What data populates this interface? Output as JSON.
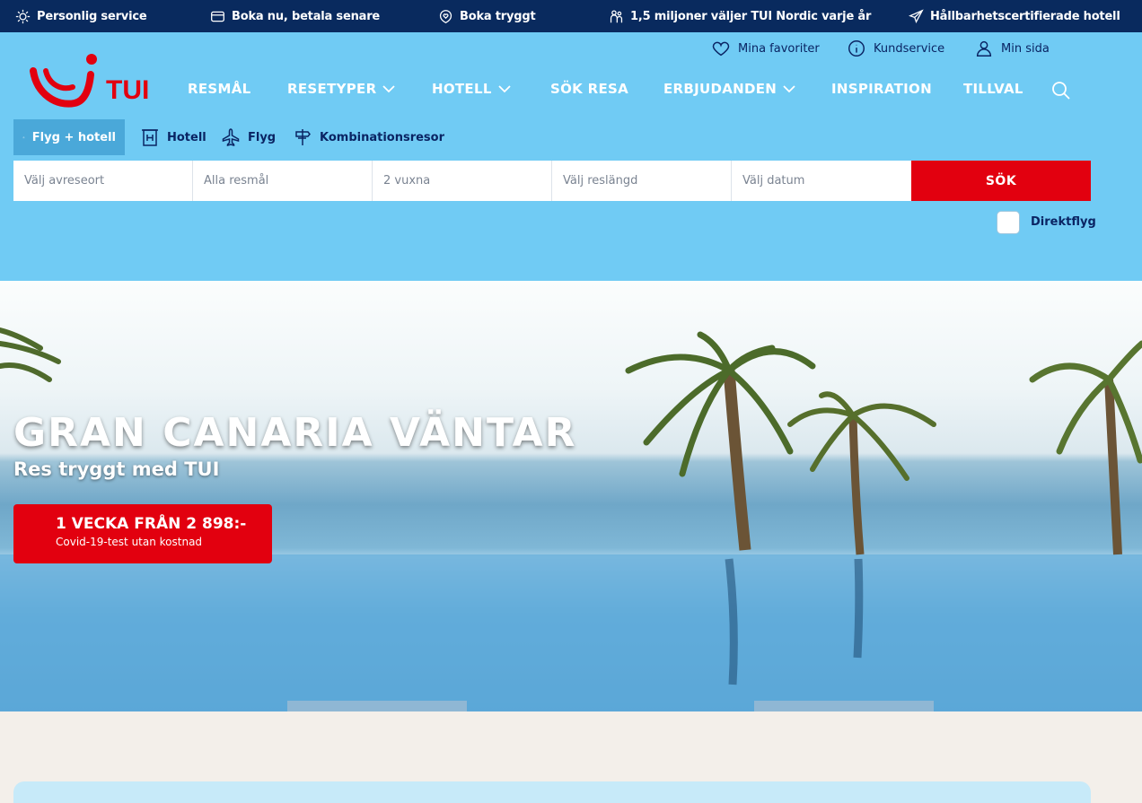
{
  "topbar": {
    "items": [
      {
        "label": "Personlig service",
        "icon": "sun-icon"
      },
      {
        "label": "Boka nu, betala senare",
        "icon": "card-icon"
      },
      {
        "label": "Boka tryggt",
        "icon": "shield-heart-icon"
      },
      {
        "label": "1,5 miljoner väljer TUI Nordic varje år",
        "icon": "people-icon"
      },
      {
        "label": "Hållbarhetscertifierade hotell",
        "icon": "paper-plane-icon"
      }
    ]
  },
  "utility": {
    "favorites": "Mina favoriter",
    "service": "Kundservice",
    "account": "Min sida"
  },
  "logo": {
    "text": "TUI"
  },
  "nav": {
    "items": [
      {
        "label": "RESMÅL",
        "dropdown": false
      },
      {
        "label": "RESETYPER",
        "dropdown": true
      },
      {
        "label": "HOTELL",
        "dropdown": true
      },
      {
        "label": "SÖK RESA",
        "dropdown": false
      },
      {
        "label": "ERBJUDANDEN",
        "dropdown": true
      },
      {
        "label": "INSPIRATION",
        "dropdown": false
      },
      {
        "label": "TILLVAL",
        "dropdown": false
      }
    ]
  },
  "search": {
    "tabs": [
      {
        "label": "Flyg + hotell",
        "icon": "sun-icon",
        "active": true
      },
      {
        "label": "Hotell",
        "icon": "hotel-icon",
        "active": false
      },
      {
        "label": "Flyg",
        "icon": "plane-icon",
        "active": false
      },
      {
        "label": "Kombinationsresor",
        "icon": "signpost-icon",
        "active": false
      }
    ],
    "fields": [
      {
        "placeholder": "Välj avreseort"
      },
      {
        "placeholder": "Alla resmål"
      },
      {
        "placeholder": "2 vuxna"
      },
      {
        "placeholder": "Välj reslängd"
      },
      {
        "placeholder": "Välj datum"
      }
    ],
    "submit": "SÖK",
    "direct_flight": "Direktflyg"
  },
  "hero": {
    "title": "GRAN CANARIA VÄNTAR",
    "subtitle": "Res tryggt med TUI",
    "promo_main": "1 VECKA FRÅN 2 898:-",
    "promo_small": "Covid-19-test utan kostnad"
  },
  "colors": {
    "topbar": "#092a5e",
    "header": "#70cbf4",
    "brand_red": "#e2000f",
    "navy": "#0a2463"
  }
}
